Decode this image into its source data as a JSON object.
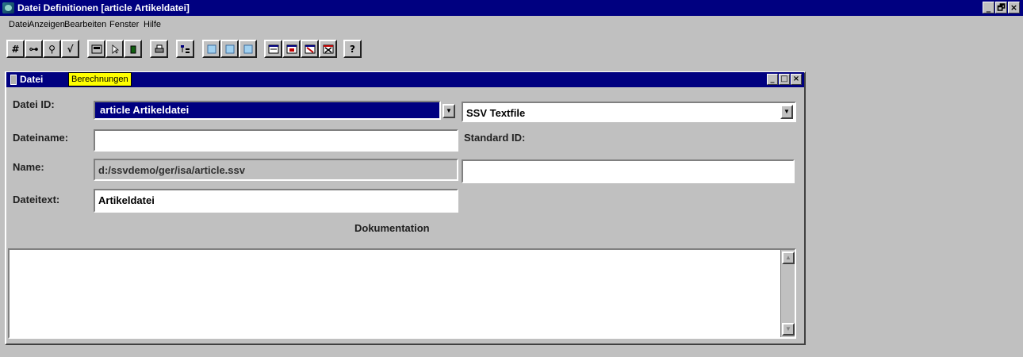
{
  "window": {
    "title": "Datei Definitionen [article Artikeldatei]"
  },
  "window_controls": [
    "_",
    "🗗",
    "×"
  ],
  "menu": [
    {
      "label": "Datei"
    },
    {
      "label": "Anzeigen"
    },
    {
      "label": "Bearbeiten"
    },
    {
      "label": "Fenster"
    },
    {
      "label": "Hilfe"
    }
  ],
  "toolbar": {
    "buttons": [
      {
        "icon": "hash-icon",
        "glyph": "#"
      },
      {
        "icon": "key-icon",
        "glyph": "⊶"
      },
      {
        "icon": "search-icon",
        "glyph": "⚲"
      },
      {
        "icon": "check-icon",
        "glyph": "√"
      },
      {
        "icon": "calculator-icon",
        "glyph": ""
      },
      {
        "icon": "trash-icon",
        "glyph": ""
      },
      {
        "icon": "print-icon",
        "glyph": ""
      },
      {
        "icon": "tree-icon",
        "glyph": ""
      },
      {
        "icon": "page-icon",
        "glyph": ""
      },
      {
        "icon": "page-icon",
        "glyph": ""
      },
      {
        "icon": "page-icon",
        "glyph": ""
      },
      {
        "icon": "window-icon",
        "glyph": ""
      },
      {
        "icon": "window-icon",
        "glyph": ""
      },
      {
        "icon": "window-icon",
        "glyph": ""
      },
      {
        "icon": "window-icon",
        "glyph": ""
      },
      {
        "icon": "help-icon",
        "glyph": "?"
      }
    ]
  },
  "tooltip": "Berechnungen",
  "child": {
    "title": "Datei",
    "controls": [
      "_",
      "□",
      "×"
    ]
  },
  "form": {
    "datei_id_label": "Datei ID:",
    "datei_id_value": "article     Artikeldatei",
    "type_value": "SSV Textfile",
    "dateiname_label": "Dateiname:",
    "dateiname_value": "",
    "standard_id_label": "Standard ID:",
    "standard_id_value": "",
    "name_label": "Name:",
    "name_value": "d:/ssvdemo/ger/isa/article.ssv",
    "dateitext_label": "Dateitext:",
    "dateitext_value": "Artikeldatei",
    "dokumentation_label": "Dokumentation",
    "dokumentation_value": ""
  },
  "colors": {
    "titlebar": "#000080",
    "face": "#c0c0c0",
    "tooltip": "#ffff00"
  }
}
